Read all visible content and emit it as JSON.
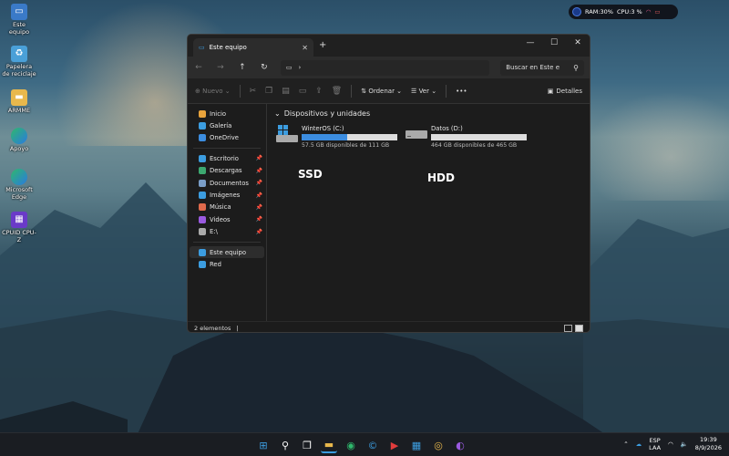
{
  "desktop": {
    "icons": [
      {
        "label": "Este equipo",
        "icon": "computer-icon"
      },
      {
        "label": "Papelera de reciclaje",
        "icon": "recycle-bin-icon"
      },
      {
        "label": "ARMME",
        "icon": "folder-icon"
      },
      {
        "label": "Apoyo",
        "icon": "edge-icon"
      },
      {
        "label": "Microsoft Edge",
        "icon": "edge-icon"
      },
      {
        "label": "CPUID CPU-Z",
        "icon": "cpuz-icon"
      }
    ]
  },
  "widget": {
    "ram": "RAM:30%",
    "cpu": "CPU:3 %"
  },
  "window": {
    "tab_title": "Este equipo",
    "close_tab": "✕",
    "new_tab": "+",
    "controls": {
      "minimize": "—",
      "maximize": "☐",
      "close": "✕"
    },
    "address": {
      "chevron": "›"
    },
    "search_placeholder": "Buscar en Este e",
    "commands": {
      "new": "Nuevo",
      "sort": "Ordenar",
      "view": "Ver",
      "more": "•••",
      "details": "Detalles"
    },
    "sidebar": [
      {
        "label": "Inicio",
        "icon": "home-icon",
        "color": "#e8a33c"
      },
      {
        "label": "Galería",
        "icon": "gallery-icon",
        "color": "#3c9de0"
      },
      {
        "label": "OneDrive",
        "icon": "onedrive-icon",
        "color": "#3c8de0"
      },
      {
        "label": "Escritorio",
        "icon": "desktop-icon",
        "color": "#3c9de0",
        "pinned": true
      },
      {
        "label": "Descargas",
        "icon": "download-icon",
        "color": "#3ca870",
        "pinned": true
      },
      {
        "label": "Documentos",
        "icon": "documents-icon",
        "color": "#7a9ec8",
        "pinned": true
      },
      {
        "label": "Imágenes",
        "icon": "pictures-icon",
        "color": "#3c9de0",
        "pinned": true
      },
      {
        "label": "Música",
        "icon": "music-icon",
        "color": "#e06a4c",
        "pinned": true
      },
      {
        "label": "Videos",
        "icon": "videos-icon",
        "color": "#9a5ae0",
        "pinned": true
      },
      {
        "label": "E:\\",
        "icon": "drive-icon",
        "color": "#aaaaaa",
        "pinned": true
      },
      {
        "label": "Este equipo",
        "icon": "computer-icon",
        "color": "#3c9de0"
      },
      {
        "label": "Red",
        "icon": "network-icon",
        "color": "#3c9de0"
      }
    ],
    "section_title": "Dispositivos y unidades",
    "drives": [
      {
        "name": "WinterOS (C:)",
        "free": "57.5 GB disponibles de 111 GB",
        "used_fraction": 0.48,
        "annotation": "SSD"
      },
      {
        "name": "Datos (D:)",
        "free": "464 GB disponibles de 465 GB",
        "used_fraction": 0.0,
        "annotation": "HDD"
      }
    ],
    "status": "2 elementos",
    "status_sep": "|"
  },
  "taskbar": {
    "lang": "ESP",
    "lang2": "LAA",
    "time": "19:39",
    "date": "8/9/2026"
  },
  "colors": {
    "accent": "#3c8de0"
  }
}
